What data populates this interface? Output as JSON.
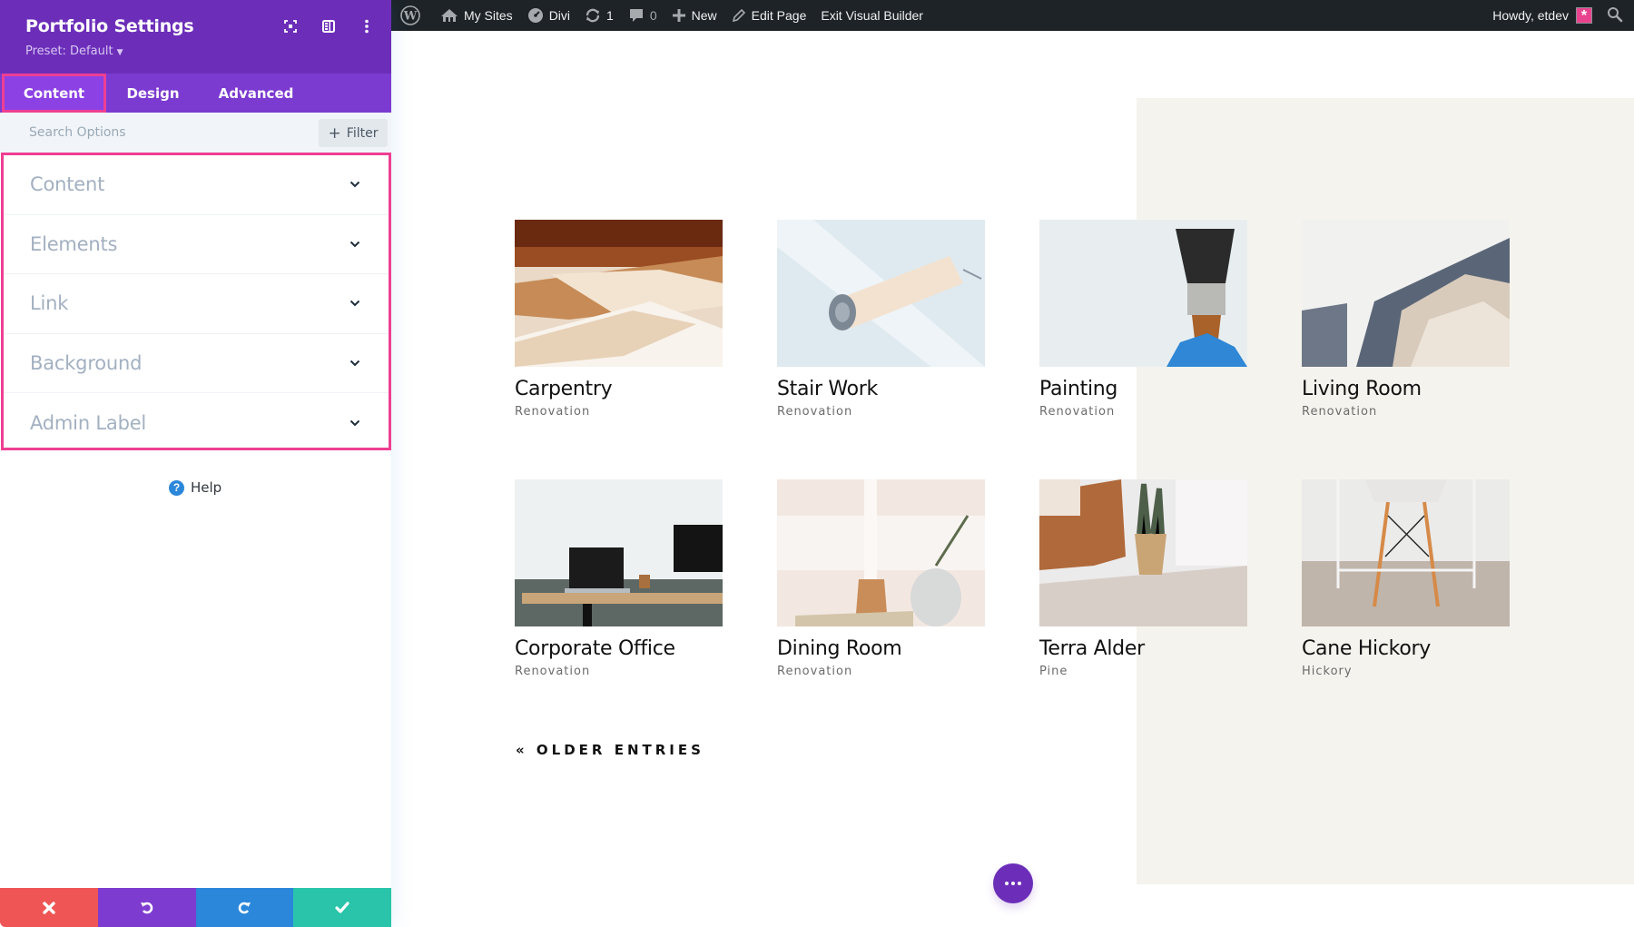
{
  "admin_bar": {
    "my_sites": "My Sites",
    "divi": "Divi",
    "updates_count": "1",
    "comments_count": "0",
    "new": "New",
    "edit_page": "Edit Page",
    "exit_builder": "Exit Visual Builder",
    "howdy": "Howdy, etdev"
  },
  "panel": {
    "title": "Portfolio Settings",
    "preset": "Preset: Default",
    "tabs": [
      {
        "label": "Content",
        "active": true
      },
      {
        "label": "Design",
        "active": false
      },
      {
        "label": "Advanced",
        "active": false
      }
    ],
    "search_placeholder": "Search Options",
    "filter_label": "Filter",
    "toggles": [
      {
        "label": "Content"
      },
      {
        "label": "Elements"
      },
      {
        "label": "Link"
      },
      {
        "label": "Background"
      },
      {
        "label": "Admin Label"
      }
    ],
    "help_label": "Help"
  },
  "colors": {
    "panel_header": "#6c2eb9",
    "tab_bar": "#7b3ad0",
    "highlight": "#ee3f93",
    "close": "#ef5555",
    "undo": "#7e3bd0",
    "redo": "#2b87da",
    "save": "#29c4a9",
    "section_bg": "#f5f3ee"
  },
  "portfolio": {
    "items": [
      {
        "title": "Carpentry",
        "category": "Renovation",
        "image": "carpentry"
      },
      {
        "title": "Stair Work",
        "category": "Renovation",
        "image": "paint-roller"
      },
      {
        "title": "Painting",
        "category": "Renovation",
        "image": "paint-brush"
      },
      {
        "title": "Living Room",
        "category": "Renovation",
        "image": "living-room"
      },
      {
        "title": "Corporate Office",
        "category": "Renovation",
        "image": "office-desk"
      },
      {
        "title": "Dining Room",
        "category": "Renovation",
        "image": "dining-room"
      },
      {
        "title": "Terra Alder",
        "category": "Pine",
        "image": "leather-chair"
      },
      {
        "title": "Cane Hickory",
        "category": "Hickory",
        "image": "white-chair"
      }
    ],
    "older_entries": "« OLDER ENTRIES"
  }
}
